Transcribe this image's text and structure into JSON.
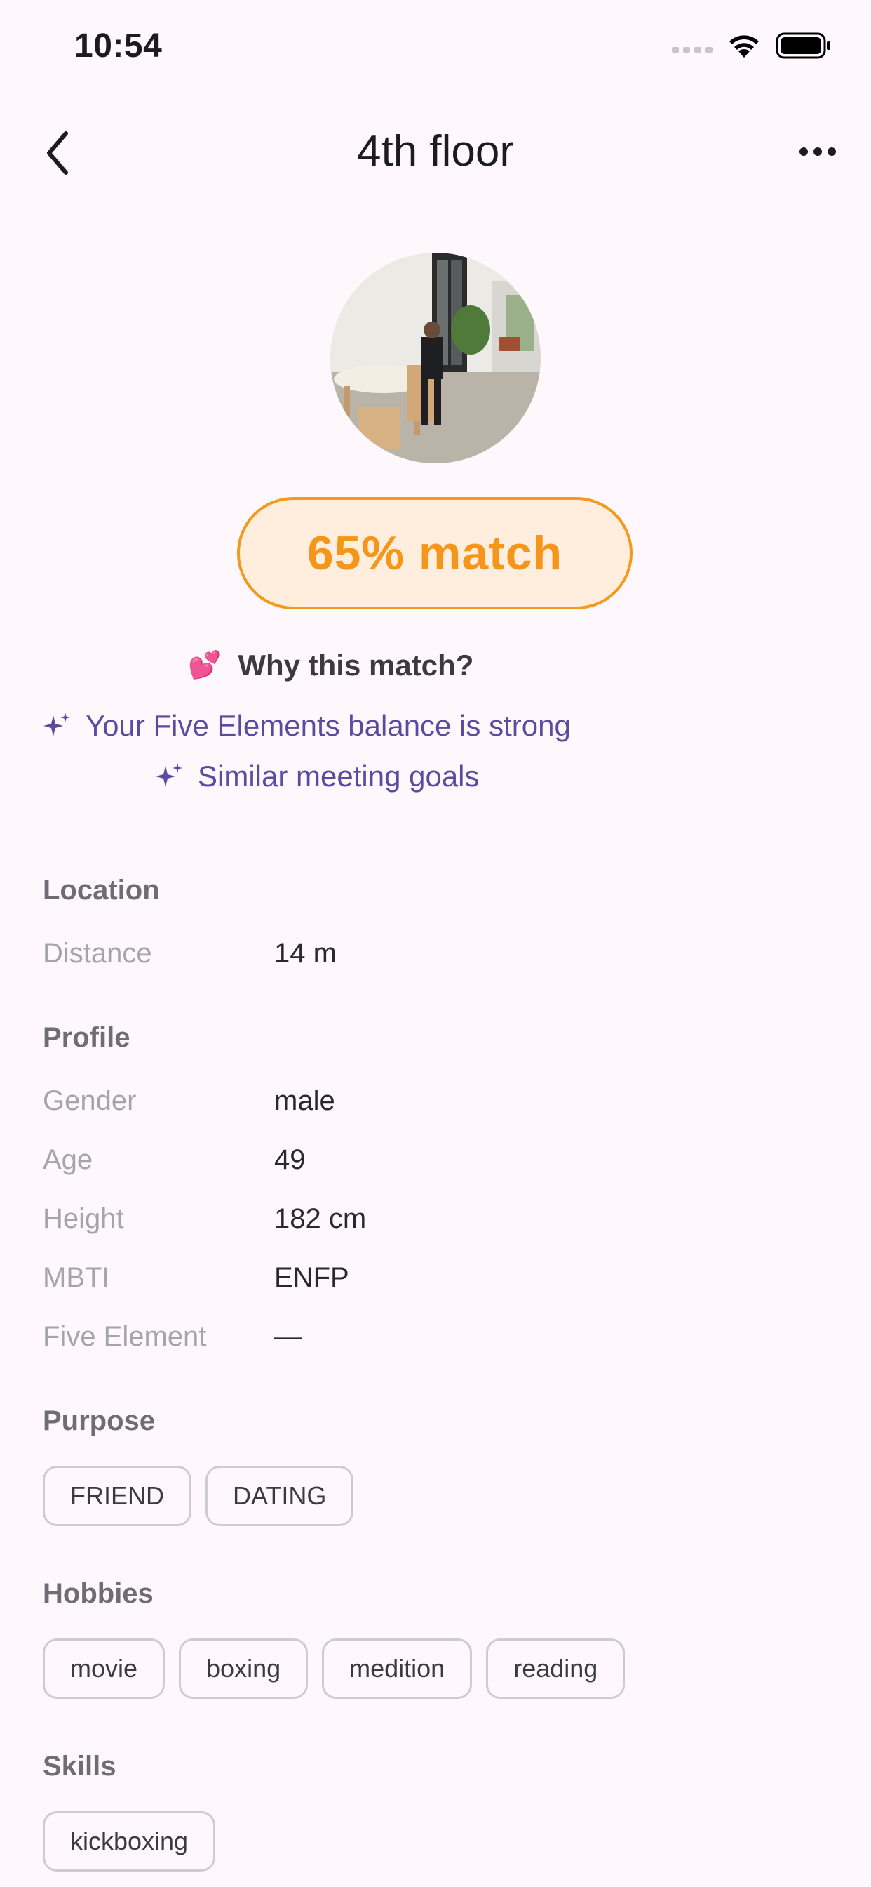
{
  "status_bar": {
    "time": "10:54"
  },
  "app_bar": {
    "title": "4th floor"
  },
  "match": {
    "label": "65% match"
  },
  "why": {
    "emoji": "💕",
    "title": "Why this match?",
    "reasons": [
      "Your Five Elements balance is strong",
      "Similar meeting goals"
    ]
  },
  "location": {
    "title": "Location",
    "rows": [
      {
        "label": "Distance",
        "value": "14 m"
      }
    ]
  },
  "profile": {
    "title": "Profile",
    "rows": [
      {
        "label": "Gender",
        "value": "male"
      },
      {
        "label": "Age",
        "value": "49"
      },
      {
        "label": "Height",
        "value": "182 cm"
      },
      {
        "label": "MBTI",
        "value": "ENFP"
      },
      {
        "label": "Five Element",
        "value": "—"
      }
    ]
  },
  "purpose": {
    "title": "Purpose",
    "chips": [
      "FRIEND",
      "DATING"
    ]
  },
  "hobbies": {
    "title": "Hobbies",
    "chips": [
      "movie",
      "boxing",
      "medition",
      "reading"
    ]
  },
  "skills": {
    "title": "Skills",
    "chips": [
      "kickboxing"
    ]
  },
  "colors": {
    "accent_orange": "#f5961a",
    "pill_bg": "#ffeedd",
    "reason_purple": "#5a4aa0",
    "background": "#fef8fd"
  },
  "icons": {
    "back": "chevron-left-icon",
    "more": "more-horizontal-icon",
    "sparkle": "sparkle-icon",
    "signal": "signal-icon",
    "wifi": "wifi-icon",
    "battery": "battery-icon"
  }
}
